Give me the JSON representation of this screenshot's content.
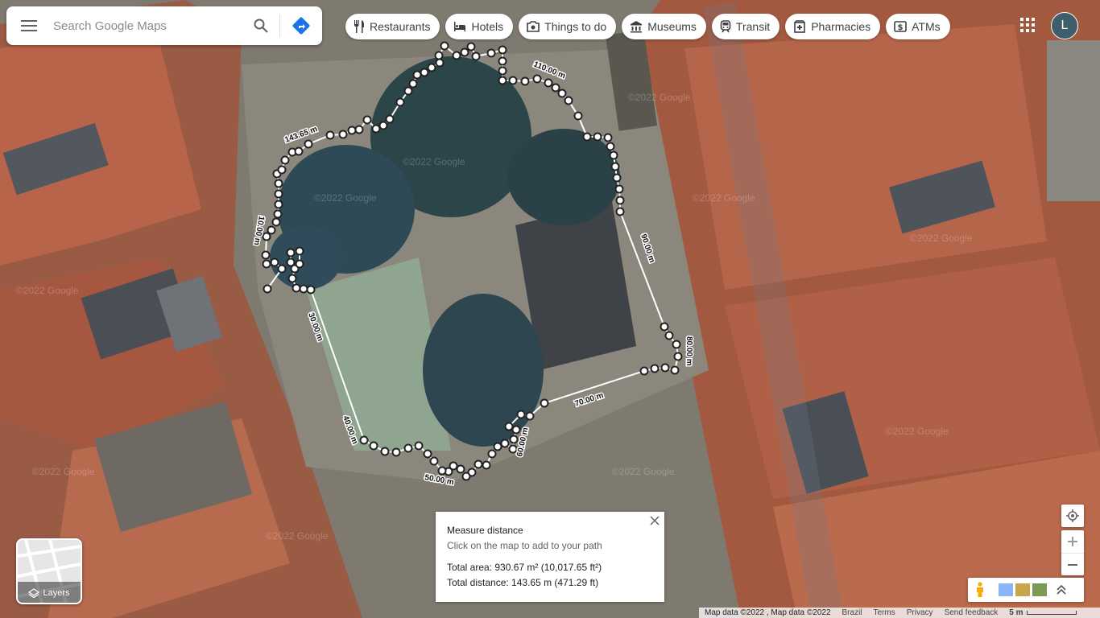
{
  "search": {
    "placeholder": "Search Google Maps"
  },
  "chips": [
    {
      "label": "Restaurants",
      "icon": "fork-knife-icon"
    },
    {
      "label": "Hotels",
      "icon": "bed-icon"
    },
    {
      "label": "Things to do",
      "icon": "camera-icon"
    },
    {
      "label": "Museums",
      "icon": "museum-icon"
    },
    {
      "label": "Transit",
      "icon": "train-icon"
    },
    {
      "label": "Pharmacies",
      "icon": "pharmacy-icon"
    },
    {
      "label": "ATMs",
      "icon": "atm-icon"
    }
  ],
  "account": {
    "initial": "L"
  },
  "layers": {
    "label": "Layers"
  },
  "measure": {
    "title": "Measure distance",
    "hint": "Click on the map to add to your path",
    "total_area": "Total area: 930.67 m² (10,017.65 ft²)",
    "total_distance": "Total distance: 143.65 m (471.29 ft)"
  },
  "path_labels": [
    "143.65 m",
    "110.00 m",
    "90.00 m",
    "80.00 m",
    "70.00 m",
    "60.00 m",
    "50.00 m",
    "40.00 m",
    "30.00 m",
    "10.00 m"
  ],
  "watermark": "©2022 Google",
  "footer": {
    "map_data": "Map data ©2022 , Map data ©2022",
    "country": "Brazil",
    "terms": "Terms",
    "privacy": "Privacy",
    "feedback": "Send feedback",
    "scale": "5 m"
  },
  "colors": {
    "accent": "#1a73e8",
    "avatar": "#3f5e6b",
    "roof": "#b8644a",
    "road": "#7f7a70",
    "tree": "#2d4a4e"
  }
}
